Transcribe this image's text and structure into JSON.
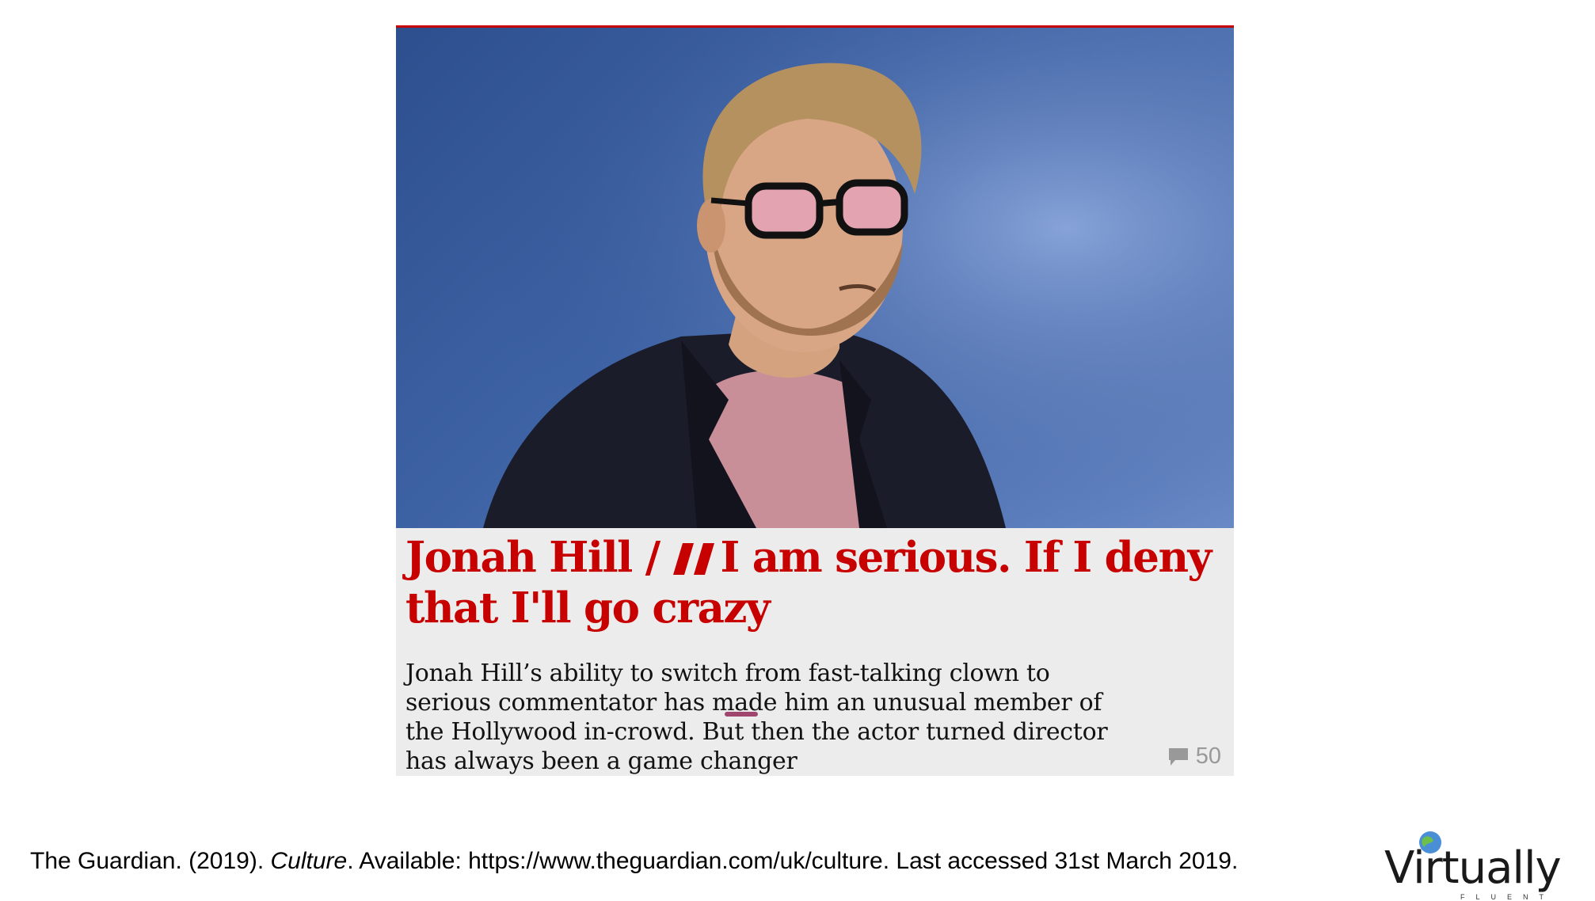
{
  "article": {
    "photo_alt": "Jonah Hill",
    "kicker": "Jonah Hill /",
    "headline": "I am serious. If I deny that I'll go crazy",
    "standfirst_parts": [
      "Jonah Hill’s ability to switch from fast-talking clown to serious commentator has made him ",
      "an",
      " unusual member of the Hollywood in-crowd. But then the actor turned director has always been ",
      "a",
      " game changer"
    ],
    "comment_count": "50",
    "accent_color": "#c70000",
    "underline_color": "#a0466e"
  },
  "citation": {
    "before": "The Guardian. (2019). ",
    "italic": "Culture",
    "after": ". Available: https://www.theguardian.com/uk/culture.  Last accessed 31st March 2019."
  },
  "logo": {
    "word": "Virtually",
    "sub": "FLUENT"
  }
}
